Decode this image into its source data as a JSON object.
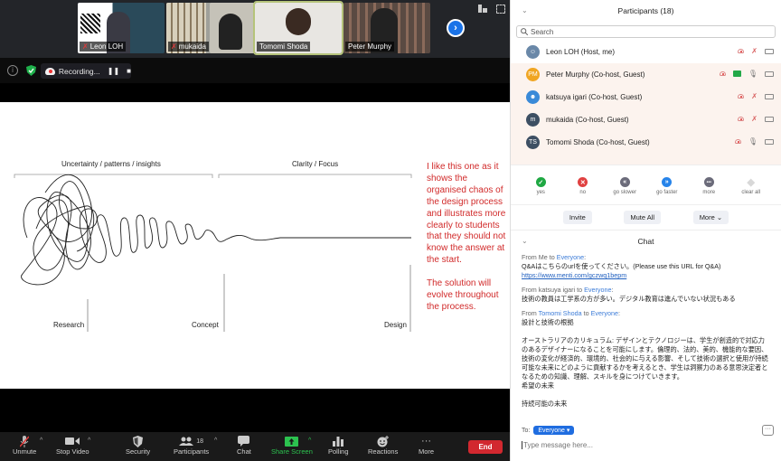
{
  "gallery": {
    "tiles": [
      {
        "name": "Leon LOH",
        "muted": true
      },
      {
        "name": "mukaida",
        "muted": true
      },
      {
        "name": "",
        "muted": false
      },
      {
        "name": "Tomomi Shoda",
        "muted": false
      },
      {
        "name": "Peter Murphy",
        "muted": false
      }
    ],
    "next_icon": "›"
  },
  "status": {
    "recording_label": "Recording...",
    "pause_icon": "❚❚",
    "stop_icon": "■",
    "info_icon": "i"
  },
  "slide": {
    "left_header": "Uncertainty / patterns / insights",
    "right_header": "Clarity / Focus",
    "stage_labels": [
      "Research",
      "Concept",
      "Design"
    ],
    "note_paragraphs": [
      "I like this one as it shows the organised chaos of the design process and illustrates more clearly to students that they should not know the answer at the start.",
      "The solution will evolve throughout the process."
    ]
  },
  "toolbar": {
    "unmute": "Unmute",
    "stop_video": "Stop Video",
    "security": "Security",
    "participants": "Participants",
    "participants_count": "18",
    "chat": "Chat",
    "share_screen": "Share Screen",
    "polling": "Polling",
    "reactions": "Reactions",
    "more": "More",
    "end": "End",
    "caret": "^"
  },
  "participants_panel": {
    "title": "Participants (18)",
    "search_placeholder": "Search",
    "collapse_icon": "⌄",
    "list": [
      {
        "name": "Leon LOH (Host, me)",
        "initials": "",
        "avatar_color": "#6a88a8",
        "muted": true,
        "sharing": false
      },
      {
        "name": "Peter Murphy (Co-host, Guest)",
        "initials": "PM",
        "avatar_color": "#f0a521",
        "muted": false,
        "sharing": true
      },
      {
        "name": "katsuya igari (Co-host, Guest)",
        "initials": "",
        "avatar_color": "#3a8ad8",
        "muted": true,
        "sharing": false
      },
      {
        "name": "mukaida (Co-host, Guest)",
        "initials": "m",
        "avatar_color": "#3d4f63",
        "muted": true,
        "sharing": false
      },
      {
        "name": "Tomomi Shoda (Co-host, Guest)",
        "initials": "TS",
        "avatar_color": "#3d4f63",
        "muted": false,
        "sharing": false
      }
    ],
    "reactions": [
      {
        "label": "yes",
        "glyph": "✓",
        "color": "#1fa843"
      },
      {
        "label": "no",
        "glyph": "✕",
        "color": "#e04141"
      },
      {
        "label": "go slower",
        "glyph": "«",
        "color": "#6b6b7a"
      },
      {
        "label": "go faster",
        "glyph": "»",
        "color": "#2784ea"
      },
      {
        "label": "more",
        "glyph": "•••",
        "color": "#6b6b7a"
      },
      {
        "label": "clear all",
        "glyph": "◆",
        "color": "#d8d8d8"
      }
    ],
    "buttons": {
      "invite": "Invite",
      "mute_all": "Mute All",
      "more": "More ⌄"
    }
  },
  "chat": {
    "title": "Chat",
    "messages": [
      {
        "from": "Me",
        "to": "Everyone",
        "lines": [
          "Q&Aはこちらのurlを使ってください。(Please use this URL for Q&A)"
        ],
        "link": "https://www.menti.com/gczwq1bepm"
      },
      {
        "from": "katsuya igari",
        "to": "Everyone",
        "lines": [
          "技術の教員は工学系の方が多い。デジタル教育は進んでいない状況もある"
        ],
        "link": ""
      },
      {
        "from": "Tomomi Shoda",
        "to": "Everyone",
        "lines": [
          "設計と技術の根拠"
        ],
        "link": ""
      }
    ],
    "continuation": [
      "オーストラリアのカリキュラム: デザインとテクノロジーは、学生が創造的で対応力のあるデザイナーになることを可能にします。倫理的、法的、美的、機能的な要因、技術の変化が経済的、環境的、社会的に与える影響、そして技術の選択と使用が持続可能な未来にどのように貢献するかを考えるとき、学生は洞察力のある意思決定者となるための知識、理解、スキルを身につけていきます。",
      "希望の未来",
      "",
      "持続可能の未来"
    ],
    "from_prefix": "From",
    "to_word": "to",
    "to_label": "To:",
    "recipient": "Everyone ▾",
    "input_placeholder": "Type message here...",
    "more_icon": "···"
  }
}
